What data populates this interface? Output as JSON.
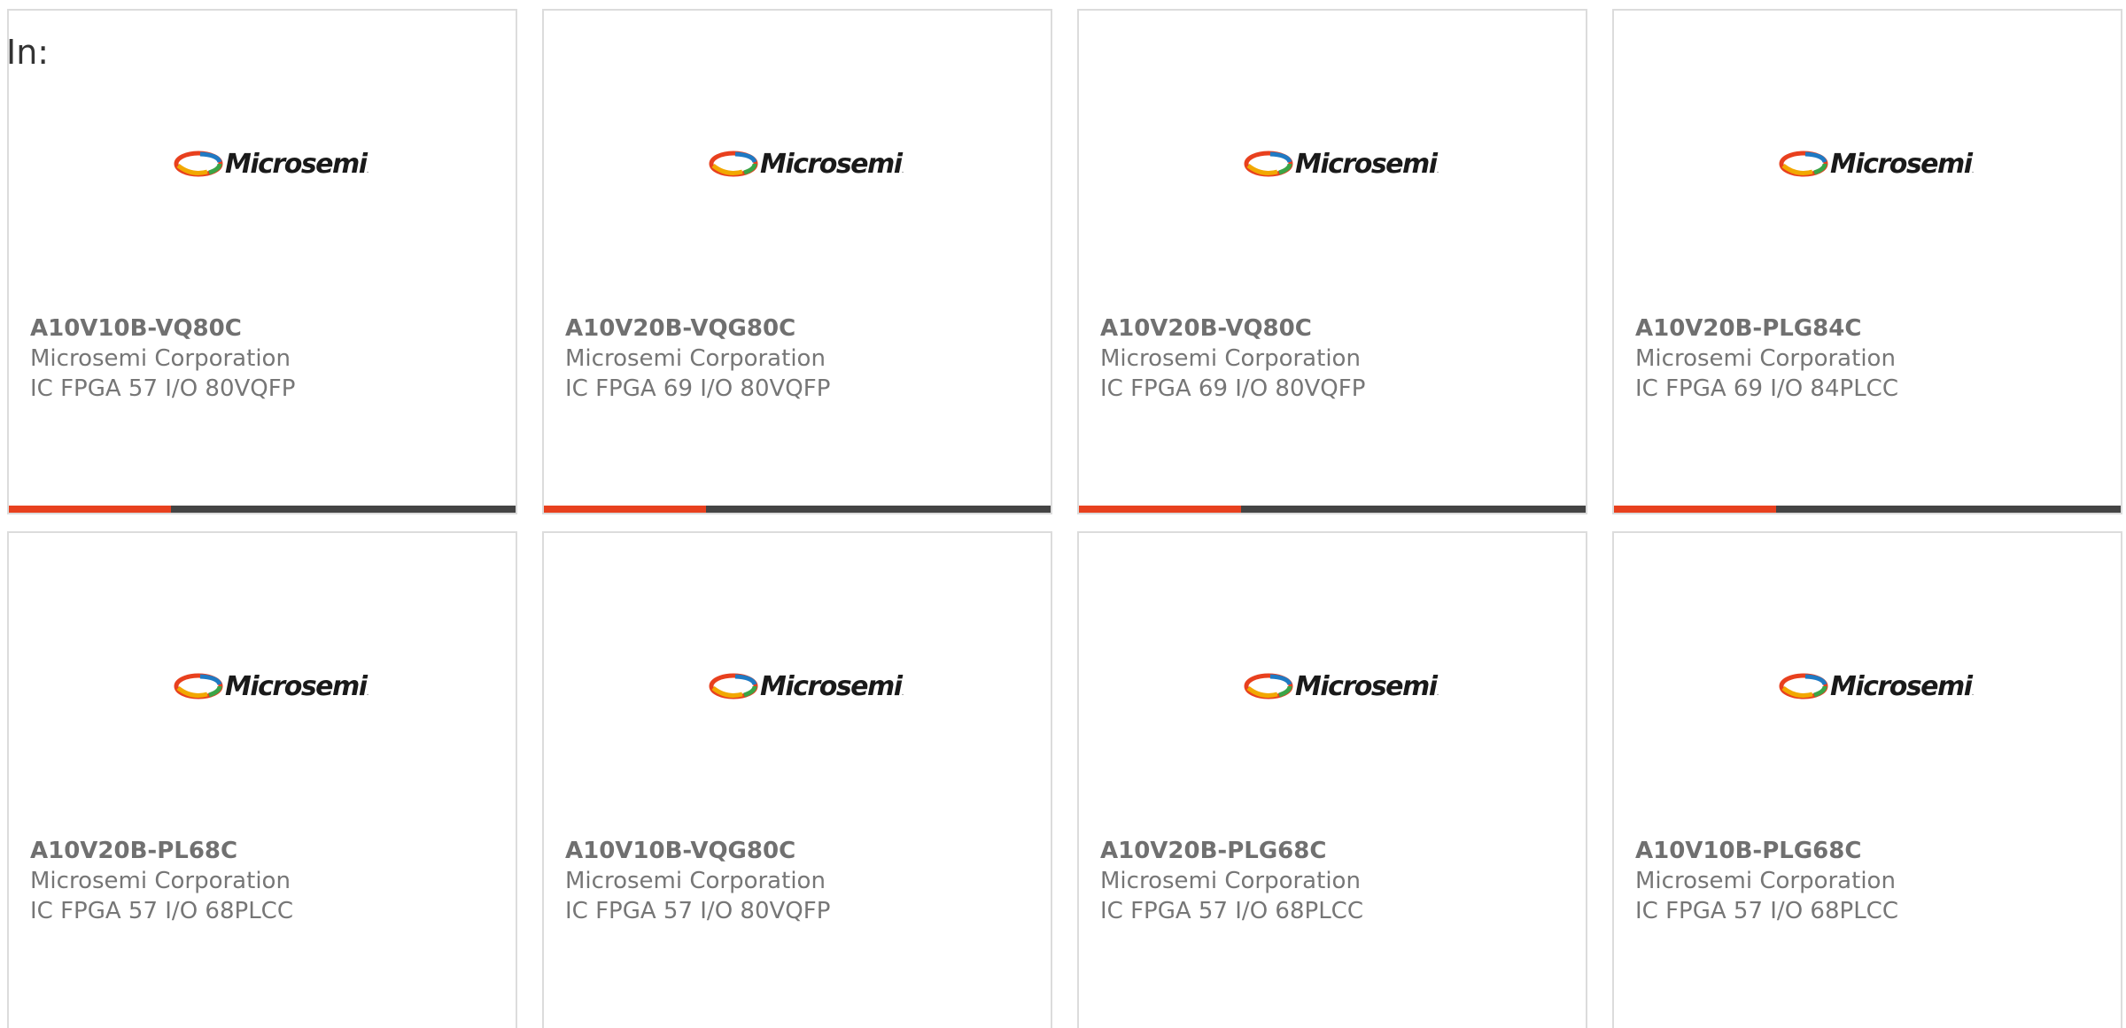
{
  "filter": {
    "label": "In:"
  },
  "colors": {
    "accent": "#e8401e",
    "bar_track": "#444444",
    "card_border": "#dcdcdc",
    "text_muted": "#767676"
  },
  "logo": {
    "text": "Microsemi",
    "icon": "microsemi-logo"
  },
  "products": [
    {
      "part_number": "A10V10B-VQ80C",
      "manufacturer": "Microsemi Corporation",
      "description": "IC FPGA 57 I/O 80VQFP",
      "bar_fill_percent": 32
    },
    {
      "part_number": "A10V20B-VQG80C",
      "manufacturer": "Microsemi Corporation",
      "description": "IC FPGA 69 I/O 80VQFP",
      "bar_fill_percent": 32
    },
    {
      "part_number": "A10V20B-VQ80C",
      "manufacturer": "Microsemi Corporation",
      "description": "IC FPGA 69 I/O 80VQFP",
      "bar_fill_percent": 32
    },
    {
      "part_number": "A10V20B-PLG84C",
      "manufacturer": "Microsemi Corporation",
      "description": "IC FPGA 69 I/O 84PLCC",
      "bar_fill_percent": 32
    },
    {
      "part_number": "A10V20B-PL68C",
      "manufacturer": "Microsemi Corporation",
      "description": "IC FPGA 57 I/O 68PLCC"
    },
    {
      "part_number": "A10V10B-VQG80C",
      "manufacturer": "Microsemi Corporation",
      "description": "IC FPGA 57 I/O 80VQFP"
    },
    {
      "part_number": "A10V20B-PLG68C",
      "manufacturer": "Microsemi Corporation",
      "description": "IC FPGA 57 I/O 68PLCC"
    },
    {
      "part_number": "A10V10B-PLG68C",
      "manufacturer": "Microsemi Corporation",
      "description": "IC FPGA 57 I/O 68PLCC"
    }
  ]
}
